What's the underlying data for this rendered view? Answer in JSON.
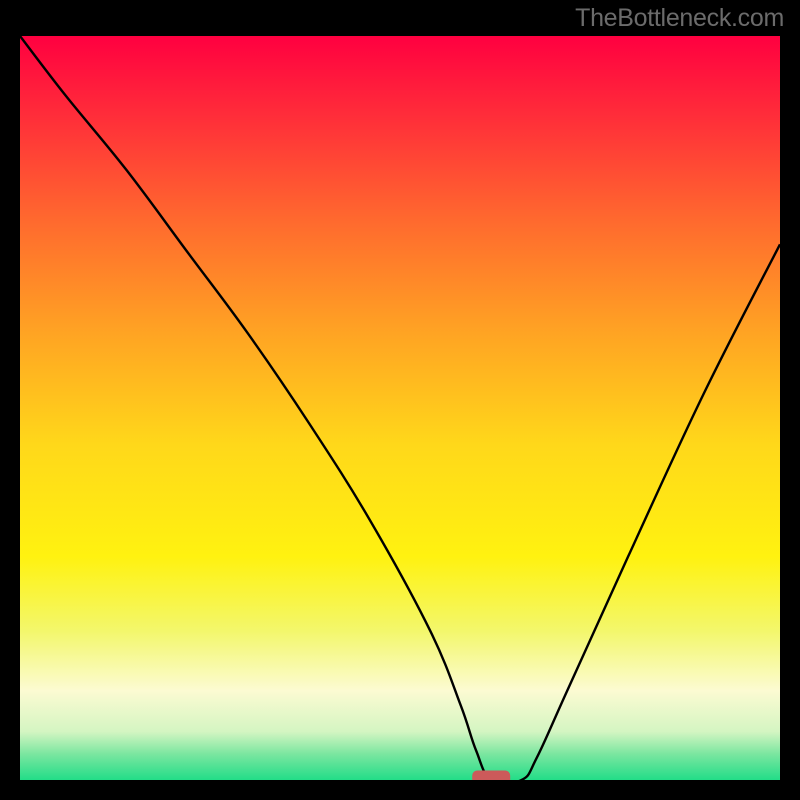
{
  "attribution": "TheBottleneck.com",
  "chart_data": {
    "type": "line",
    "title": "",
    "xlabel": "",
    "ylabel": "",
    "xlim": [
      0,
      100
    ],
    "ylim": [
      0,
      100
    ],
    "grid": false,
    "legend": false,
    "background": {
      "kind": "vertical-gradient",
      "stops": [
        {
          "pos": 0.0,
          "color": "#ff0040"
        },
        {
          "pos": 0.1,
          "color": "#ff2a3a"
        },
        {
          "pos": 0.25,
          "color": "#ff6a2e"
        },
        {
          "pos": 0.4,
          "color": "#ffa423"
        },
        {
          "pos": 0.55,
          "color": "#ffd81a"
        },
        {
          "pos": 0.7,
          "color": "#fff210"
        },
        {
          "pos": 0.8,
          "color": "#f3f76c"
        },
        {
          "pos": 0.88,
          "color": "#fcfbd2"
        },
        {
          "pos": 0.935,
          "color": "#d4f5c2"
        },
        {
          "pos": 0.965,
          "color": "#7be6a0"
        },
        {
          "pos": 1.0,
          "color": "#22dd88"
        }
      ]
    },
    "series": [
      {
        "name": "bottleneck-curve",
        "stroke": "#000000",
        "x": [
          0,
          6,
          14,
          22,
          30,
          38,
          46,
          54,
          58,
          60,
          62,
          66,
          68,
          72,
          80,
          90,
          100
        ],
        "y": [
          100,
          92,
          82,
          71,
          60,
          48,
          35,
          20,
          10,
          4,
          0,
          0,
          3,
          12,
          30,
          52,
          72
        ]
      }
    ],
    "markers": [
      {
        "name": "optimum-marker",
        "shape": "rounded-rect",
        "cx": 62,
        "cy": 0,
        "w": 5,
        "h": 2,
        "fill": "#cc5a5a"
      }
    ]
  }
}
